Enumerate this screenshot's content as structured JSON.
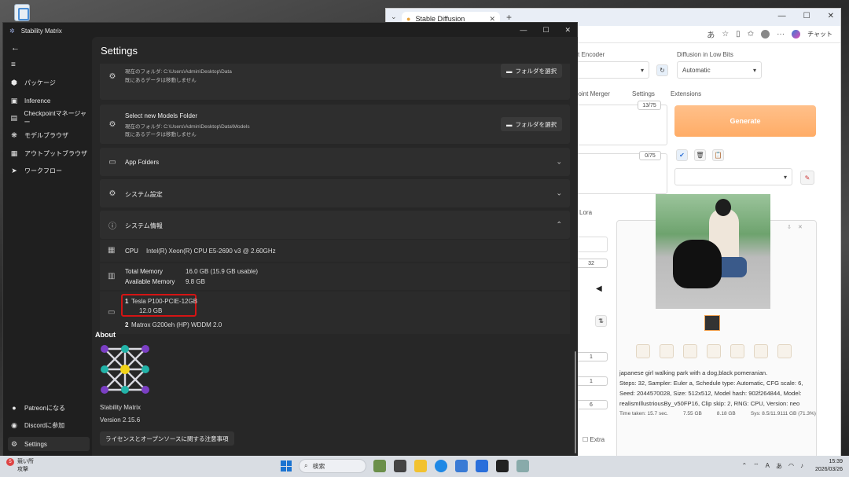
{
  "browser": {
    "tab_title": "Stable Diffusion",
    "chat_label": "チャット",
    "sd": {
      "text_encoder_label": "xt Encoder",
      "low_bits_label": "Diffusion in Low Bits",
      "low_bits_value": "Automatic",
      "tabs": [
        "point Merger",
        "Settings",
        "Extensions"
      ],
      "token_count_1": "13/75",
      "token_count_2": "0/75",
      "generate_label": "Generate",
      "lora_label": "Lora",
      "steps_value": "32",
      "field_values": [
        "1",
        "1",
        "6"
      ],
      "extra_label": "Extra",
      "caption": "japanese girl walking park with a dog,black pomeranian.\nSteps: 32, Sampler: Euler a, Schedule type: Automatic, CFG scale: 6, Seed: 2044570028, Size: 512x512, Model hash: 902f264844, Model: realismIllustriousBy_v50FP16, Clip skip: 2, RNG: CPU, Version: neo",
      "time_taken": "Time taken: 15.7 sec.",
      "vram_a": "7.55 GB",
      "vram_r": "8.18 GB",
      "vram_sys": "Sys: 8.5/11.9111 GB (71.3%)"
    }
  },
  "app": {
    "title": "Stability Matrix",
    "nav": [
      {
        "label": "パッケージ",
        "icon": "cube-icon"
      },
      {
        "label": "Inference",
        "icon": "image-icon"
      },
      {
        "label": "Checkpointマネージャー",
        "icon": "notebook-icon"
      },
      {
        "label": "モデルブラウザ",
        "icon": "brain-icon"
      },
      {
        "label": "アウトプットブラウザ",
        "icon": "grid-icon"
      },
      {
        "label": "ワークフロー",
        "icon": "send-icon"
      }
    ],
    "nav_bottom": [
      {
        "label": "Patreonになる"
      },
      {
        "label": "Discordに参加"
      },
      {
        "label": "Settings"
      }
    ],
    "settings": {
      "page_title": "Settings",
      "partial_card_line1": "現在のフォルダ: C:\\Users\\Admin\\Desktop\\Data",
      "partial_card_line2": "既にあるデータは移動しません",
      "partial_card_button": "フォルダを選択",
      "models_folder_title": "Select new Models Folder",
      "models_folder_current": "現在のフォルダ: C:\\Users\\Admin\\Desktop\\Data\\Models",
      "models_folder_note": "既にあるデータは移動しません",
      "models_folder_button": "フォルダを選択",
      "app_folders": "App Folders",
      "system_settings": "システム設定",
      "system_info": "システム情報",
      "cpu_label": "CPU",
      "cpu_value": "Intel(R) Xeon(R) CPU E5-2690 v3 @ 2.60GHz",
      "total_memory_label": "Total Memory",
      "total_memory_value": "16.0 GB (15.9 GB usable)",
      "available_memory_label": "Available Memory",
      "available_memory_value": "9.8 GB",
      "gpu1_index": "1",
      "gpu1_name": "Tesla P100-PCIE-12GB",
      "gpu1_memory": "12.0 GB",
      "gpu2_index": "2",
      "gpu2_name": "Matrox G200eh (HP) WDDM 2.0",
      "about_heading": "About",
      "about_name": "Stability Matrix",
      "about_version": "Version 2.15.6",
      "license_button": "ライセンスとオープンソースに関する注意事項"
    }
  },
  "taskbar": {
    "weather_badge": "5",
    "weather_line1": "競い所",
    "weather_line2": "攻撃",
    "search_placeholder": "検索",
    "time": "15:39",
    "date": "2026/03/26"
  },
  "colors": {
    "accent_red": "#d41414",
    "generate_orange": "#ffac66",
    "logo_purple": "#7b3fc4",
    "logo_yellow": "#f2d318",
    "logo_teal": "#22b3a8"
  }
}
